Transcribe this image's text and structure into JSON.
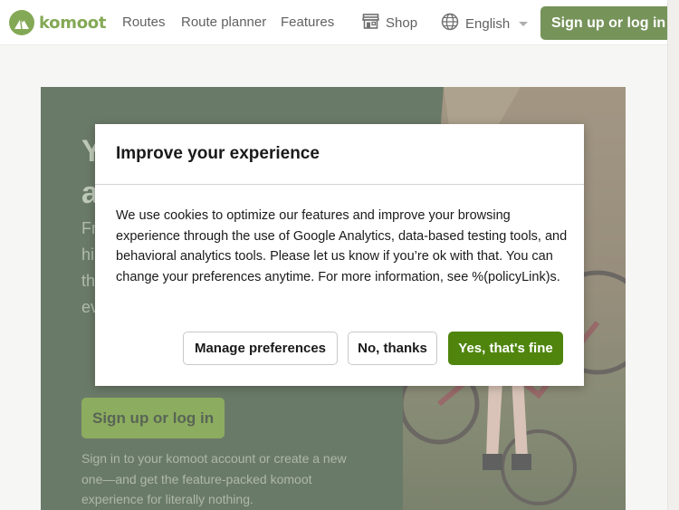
{
  "brand": {
    "name": "komoot",
    "accent": "#4f850d",
    "dark_green": "#3c6513"
  },
  "nav": {
    "links": [
      "Routes",
      "Route planner",
      "Features"
    ],
    "shop_label": "Shop",
    "shop_icon": "store-icon",
    "language_label": "English",
    "language_icon": "globe-icon",
    "signup_label": "Sign up or log in"
  },
  "hero": {
    "title_lines": [
      "Y",
      "a"
    ],
    "text_lines": [
      "Fr",
      "hi",
      "th",
      "ev"
    ],
    "signup_label": "Sign up or log in",
    "subtext": "Sign in to your komoot account or create a new one—and get the feature-packed komoot experience for literally nothing."
  },
  "dialog": {
    "title": "Improve your experience",
    "body": "We use cookies to optimize our features and improve your browsing experience through the use of Google Analytics, data-based testing tools, and behavioral analytics tools. Please let us know if you’re ok with that. You can change your preferences anytime. For more information, see %(policyLink)s.",
    "buttons": {
      "manage": "Manage preferences",
      "decline": "No, thanks",
      "accept": "Yes, that's fine"
    }
  }
}
